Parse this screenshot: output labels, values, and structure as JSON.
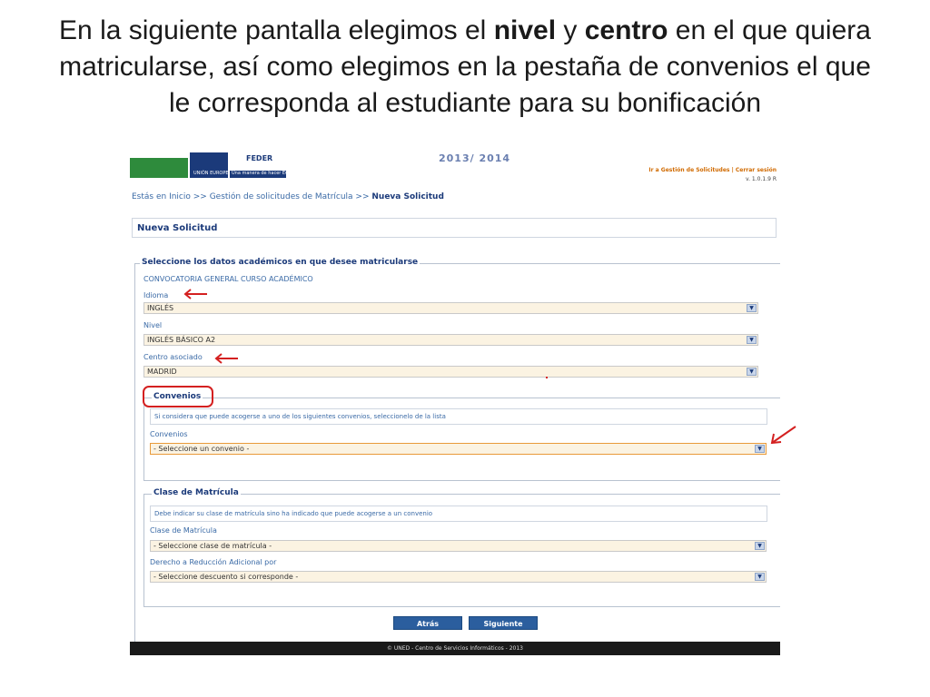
{
  "caption": {
    "part1": "En la siguiente pantalla elegimos el ",
    "bold1": "nivel",
    "part2": " y ",
    "bold2": "centro",
    "part3": " en el que quiera matricularse, así como elegimos en la pestaña de convenios el que le corresponda al estudiante para su bonificación"
  },
  "header": {
    "course_year": "2013/ 2014",
    "feder_label": "FEDER",
    "eu_label": "UNIÓN EUROPEA",
    "feder_sub": "Una manera de hacer Europa",
    "links": "Ir a Gestión de Solicitudes | Cerrar sesión",
    "version": "v. 1.0.1.9 R"
  },
  "breadcrumb": {
    "prefix": "Estás en Inicio >> Gestión de solicitudes de Matrícula >> ",
    "current": "Nueva Solicitud"
  },
  "page_title": "Nueva Solicitud",
  "academic": {
    "legend": "Seleccione los datos académicos en que desee matricularse",
    "convocatoria": "CONVOCATORIA GENERAL CURSO ACADÉMICO",
    "idioma_label": "Idioma",
    "idioma_value": "INGLÉS",
    "nivel_label": "Nivel",
    "nivel_value": "INGLÉS BÁSICO A2",
    "centro_label": "Centro asociado",
    "centro_value": "MADRID"
  },
  "convenios": {
    "legend": "Convenios",
    "info": "Si considera que puede acogerse a uno de los siguientes convenios, seleccionelo de la lista",
    "label": "Convenios",
    "value": "- Seleccione un convenio -"
  },
  "clase": {
    "legend": "Clase de Matrícula",
    "info": "Debe indicar su clase de matrícula sino ha indicado que puede acogerse a un convenio",
    "clase_label": "Clase de Matrícula",
    "clase_value": "- Seleccione clase de matrícula -",
    "derecho_label": "Derecho a Reducción Adicional por",
    "derecho_value": "- Seleccione descuento si corresponde -"
  },
  "buttons": {
    "back": "Atrás",
    "next": "Siguiente"
  },
  "footer": "© UNED - Centro de Servicios Informáticos - 2013",
  "colors": {
    "annotation_red": "#d42020",
    "brand_blue": "#1b3a7a",
    "button_blue": "#2b5e9e",
    "header_green": "#2e8b3c"
  }
}
